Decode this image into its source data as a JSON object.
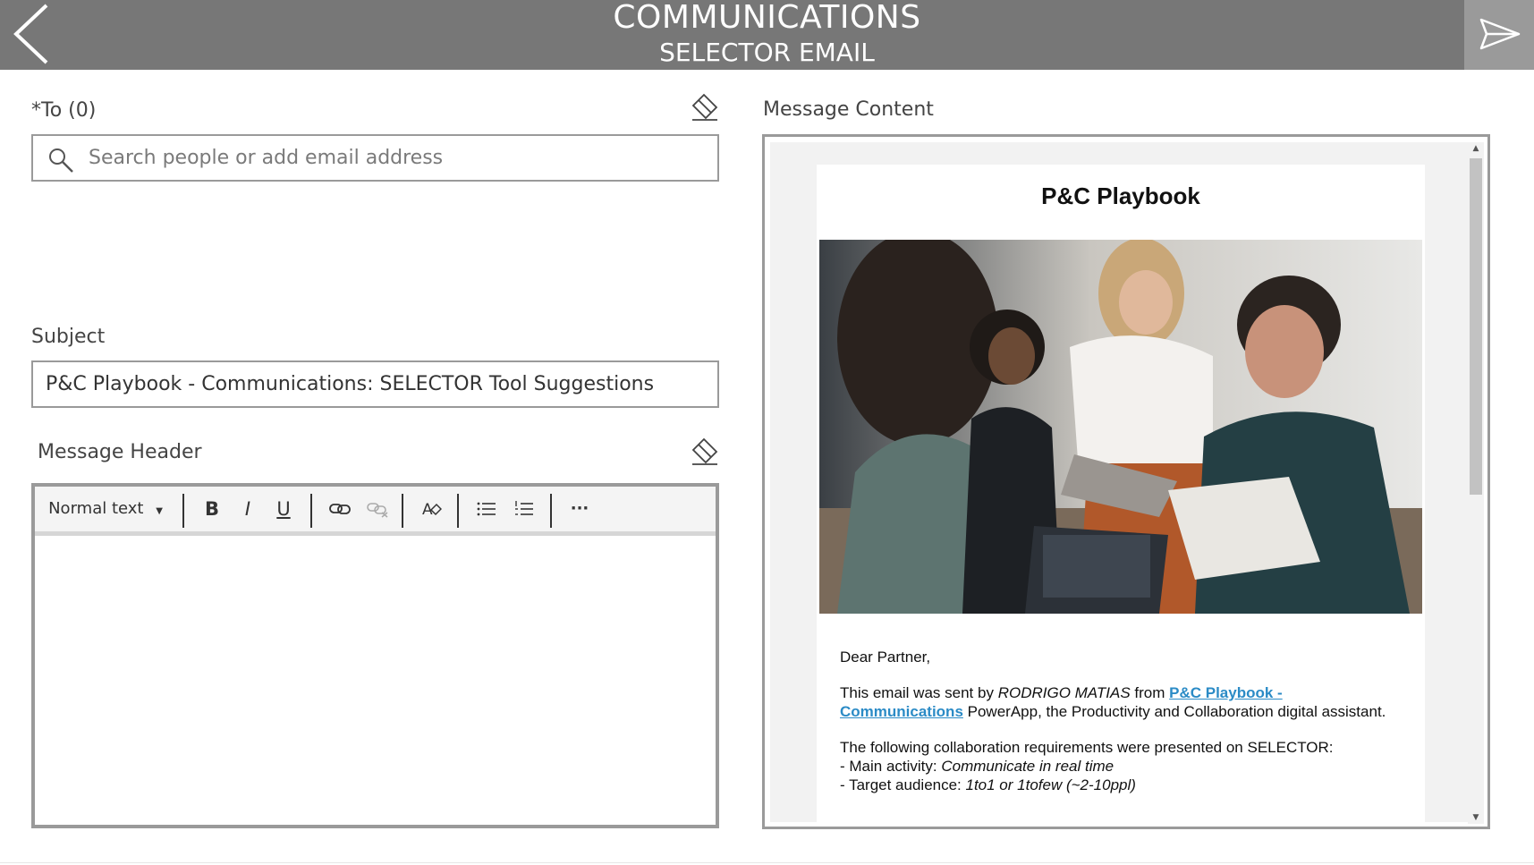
{
  "header": {
    "title": "COMMUNICATIONS",
    "subtitle": "SELECTOR EMAIL",
    "back_icon": "chevron-left-icon",
    "send_icon": "send-icon"
  },
  "to_field": {
    "label": "*To (0)",
    "placeholder": "Search people or add email address",
    "clear_icon": "eraser-icon"
  },
  "subject_field": {
    "label": "Subject",
    "value": "P&C Playbook - Communications: SELECTOR Tool Suggestions"
  },
  "message_header": {
    "label": "Message Header",
    "clear_icon": "eraser-icon",
    "toolbar": {
      "text_style": "Normal text",
      "bold": "B",
      "italic": "I",
      "underline": "U",
      "more": "···"
    },
    "body": ""
  },
  "message_content": {
    "label": "Message Content",
    "email": {
      "title": "P&C Playbook",
      "greeting": "Dear Partner,",
      "intro_prefix": "This email was sent by ",
      "sender": "RODRIGO MATIAS",
      "intro_mid": " from ",
      "link_text": "P&C Playbook - Communications",
      "intro_suffix": " PowerApp, the Productivity and Collaboration digital assistant.",
      "req_intro": "The following collaboration requirements were presented on SELECTOR:",
      "main_activity_label": "- Main activity: ",
      "main_activity_value": "Communicate in real time",
      "target_audience_label": "- Target audience: ",
      "target_audience_value": "1to1 or 1tofew (~2-10ppl)"
    }
  },
  "colors": {
    "header_bg": "#777777",
    "send_bg": "#9a9a9a",
    "border": "#9a9a9a",
    "link": "#2b8bc6"
  }
}
